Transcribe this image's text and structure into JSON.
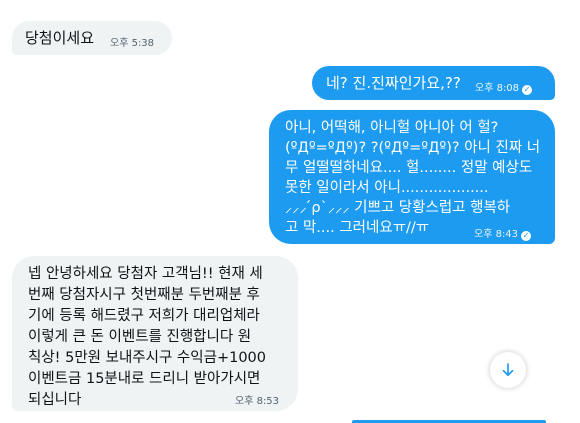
{
  "messages": [
    {
      "direction": "incoming",
      "text": "당첨이세요",
      "time": "오후 5:38"
    },
    {
      "direction": "outgoing",
      "text": "네? 진.진짜인가요,??",
      "time": "오후 8:08",
      "status_icon": "check-circle-icon"
    },
    {
      "direction": "outgoing",
      "text": "아니, 어떡해, 아니헐 아니아 어 헐?\n(ºДº=ºДº)? ?(ºДº=ºДº)? 아니 진짜 너\n무 얼떨떨하네요.... 헐........ 정말 예상도\n못한 일이라서 아니...................\n⸝⸝⸝ ́ρ`⸝⸝⸝ 기쁘고 당황스럽고 행복하\n고 막.... 그러네요ㅠ//ㅠ",
      "time": "오후 8:43",
      "status_icon": "check-circle-icon"
    },
    {
      "direction": "incoming",
      "text": "넵 안녕하세요 당첨자 고객님!! 현재 세\n번째 당첨자시구 첫번째분 두번째분 후\n기에 등록 해드렸구 저희가 대리업체라\n이렇게 큰 돈 이벤트를 진행합니다 원\n칙상! 5만원 보내주시구 수익금+1000\n이벤트금 15분내로 드리니 받아가시면\n되십니다",
      "time": "오후 8:53"
    }
  ],
  "scroll_button": {
    "icon": "arrow-down-icon"
  },
  "colors": {
    "outgoing_bubble": "#1d9bf0",
    "incoming_bubble": "#eff3f4",
    "background": "#ffffff"
  }
}
